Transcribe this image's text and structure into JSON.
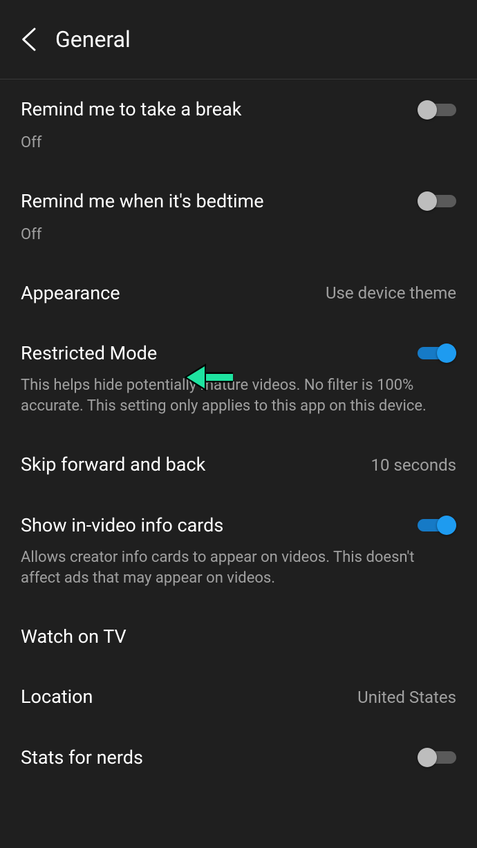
{
  "header": {
    "title": "General"
  },
  "settings": {
    "break_reminder": {
      "title": "Remind me to take a break",
      "subtitle": "Off",
      "enabled": false
    },
    "bedtime_reminder": {
      "title": "Remind me when it's bedtime",
      "subtitle": "Off",
      "enabled": false
    },
    "appearance": {
      "title": "Appearance",
      "value": "Use device theme"
    },
    "restricted_mode": {
      "title": "Restricted Mode",
      "description": "This helps hide potentially mature videos. No filter is 100% accurate. This setting only applies to this app on this device.",
      "enabled": true
    },
    "skip_amount": {
      "title": "Skip forward and back",
      "value": "10 seconds"
    },
    "info_cards": {
      "title": "Show in-video info cards",
      "description": "Allows creator info cards to appear on videos. This doesn't affect ads that may appear on videos.",
      "enabled": true
    },
    "watch_tv": {
      "title": "Watch on TV"
    },
    "location": {
      "title": "Location",
      "value": "United States"
    },
    "stats_nerds": {
      "title": "Stats for nerds",
      "enabled": false
    }
  },
  "annotation": {
    "arrow_color": "#1ee3a0",
    "arrow_points_to": "restricted-mode-title",
    "visible": true
  }
}
